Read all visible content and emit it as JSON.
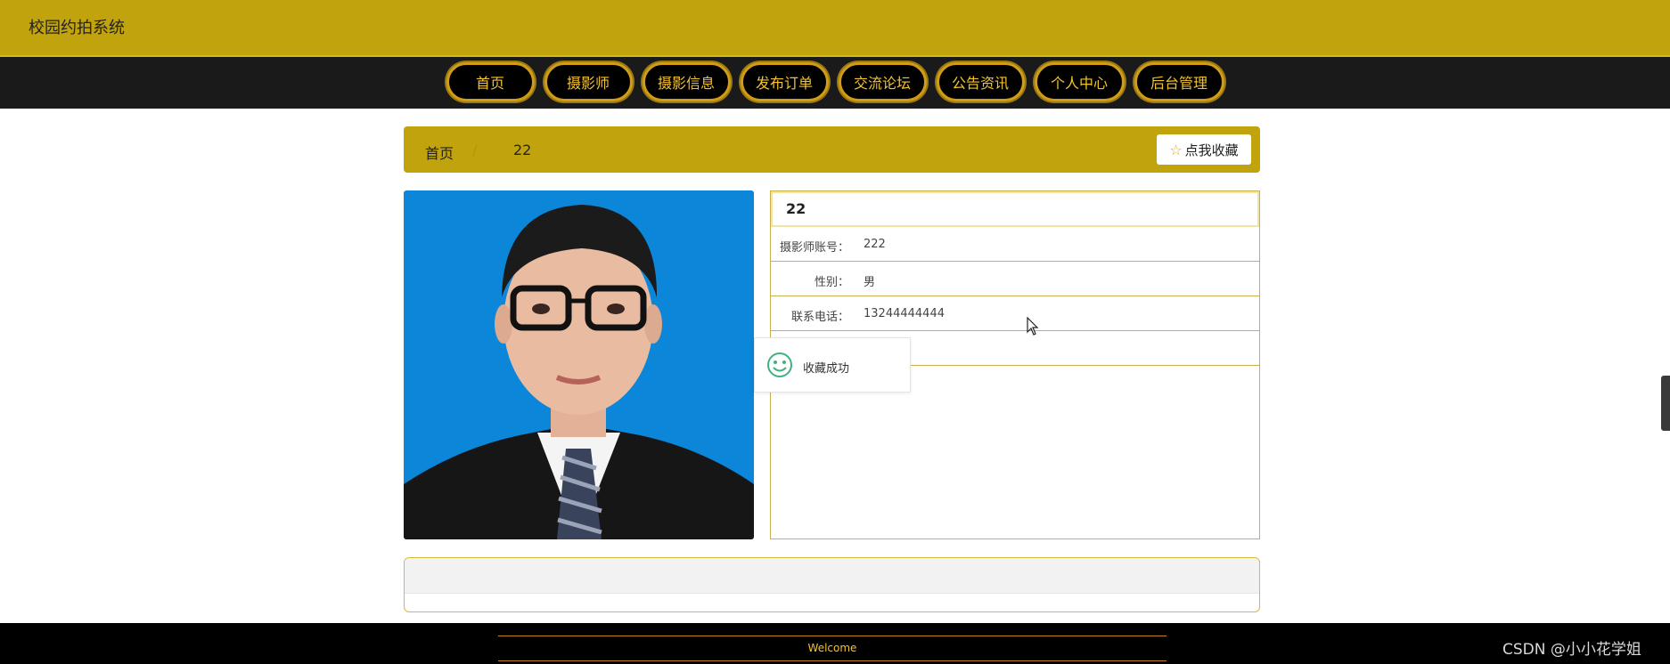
{
  "header": {
    "site_title": "校园约拍系统"
  },
  "nav": {
    "items": [
      {
        "label": "首页"
      },
      {
        "label": "摄影师"
      },
      {
        "label": "摄影信息"
      },
      {
        "label": "发布订单"
      },
      {
        "label": "交流论坛"
      },
      {
        "label": "公告资讯"
      },
      {
        "label": "个人中心"
      },
      {
        "label": "后台管理"
      }
    ]
  },
  "breadcrumb": {
    "home": "首页",
    "separator": "/",
    "current": "22"
  },
  "favorite_button": {
    "label": "点我收藏",
    "icon": "star-outline-icon"
  },
  "photographer": {
    "name": "22",
    "fields": [
      {
        "label": "摄影师账号：",
        "value": "222"
      },
      {
        "label": "性别：",
        "value": "男"
      },
      {
        "label": "联系电话：",
        "value": "13244444444"
      }
    ]
  },
  "toast": {
    "message": "收藏成功",
    "icon": "smile-icon"
  },
  "footer": {
    "text": "Welcome"
  },
  "watermark": "CSDN @小小花学姐",
  "colors": {
    "brand": "#c1a30d",
    "nav_bg": "#1a1a1a",
    "nav_text": "#f2c231",
    "toast_icon": "#3fb37f"
  }
}
